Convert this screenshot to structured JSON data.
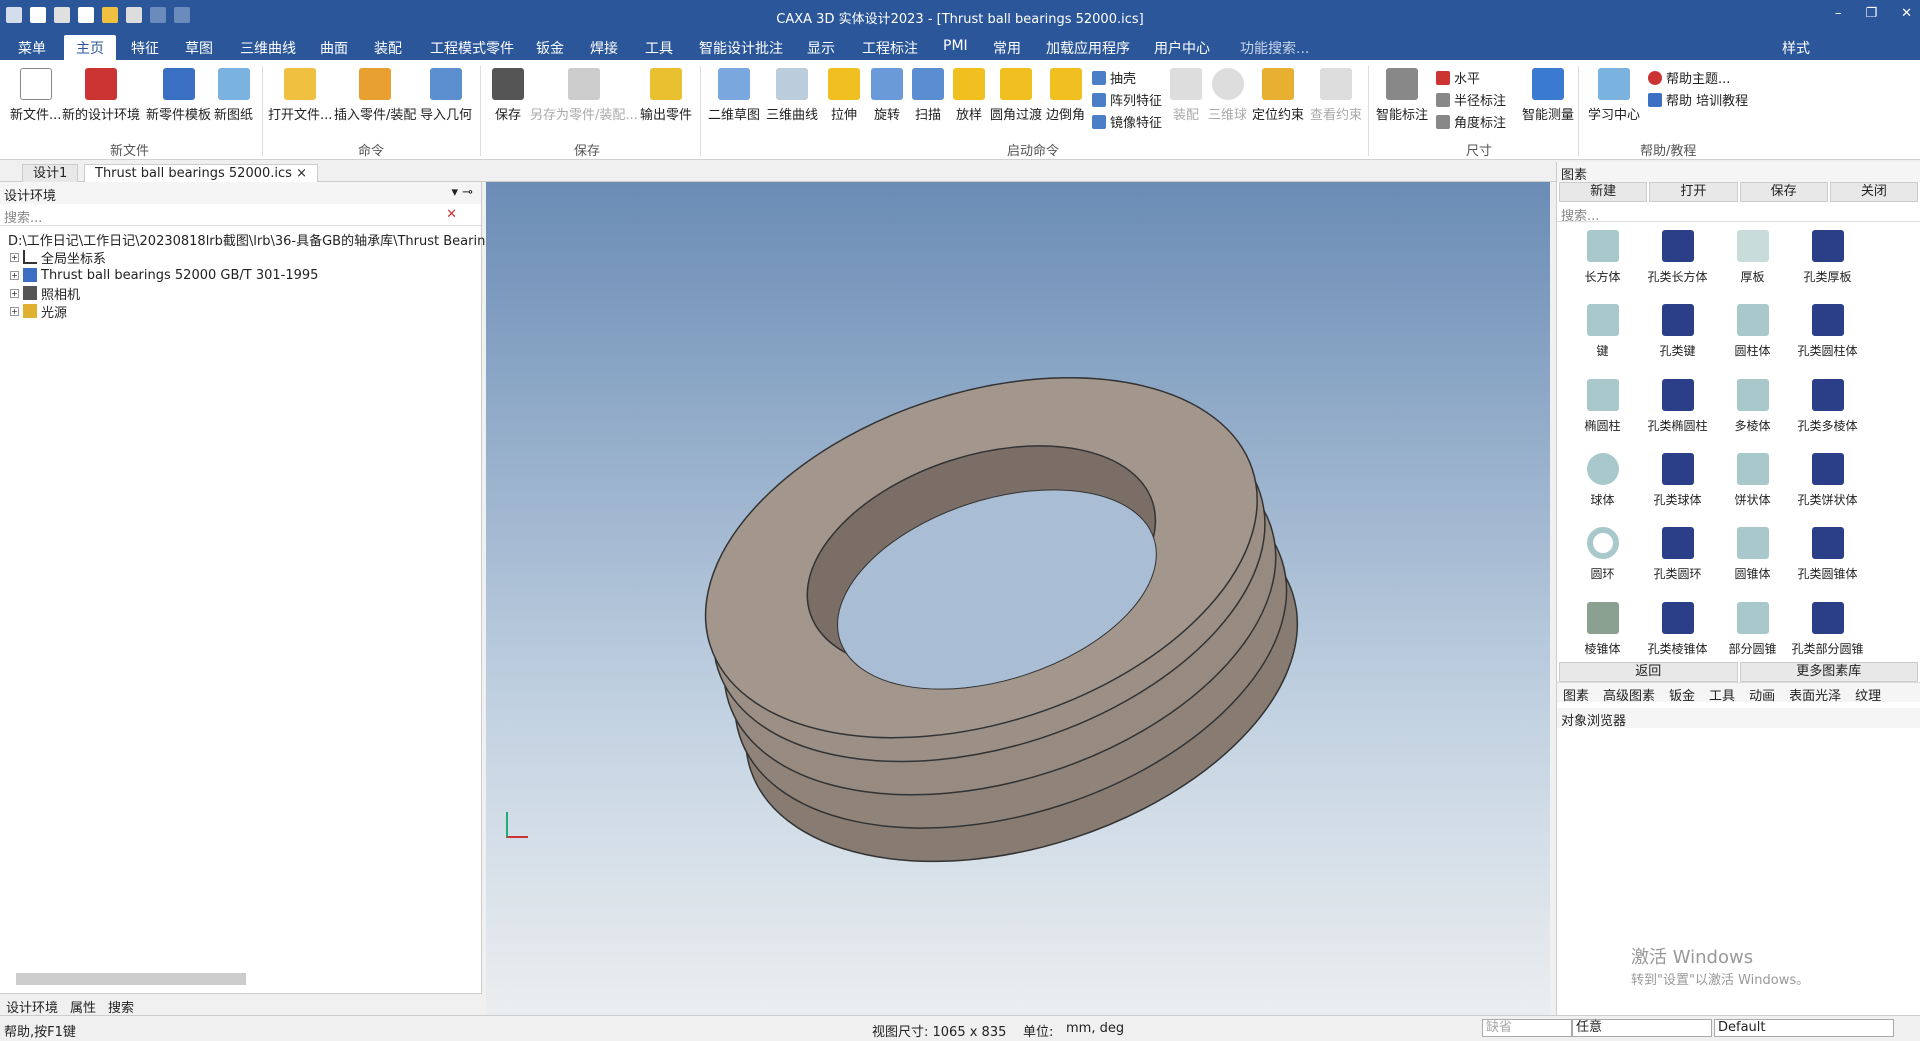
{
  "app": {
    "title": "CAXA 3D 实体设计2023 - [Thrust ball bearings 52000.ics]"
  },
  "menu": [
    "菜单",
    "主页",
    "特征",
    "草图",
    "三维曲线",
    "曲面",
    "装配",
    "工程模式零件",
    "钣金",
    "焊接",
    "工具",
    "智能设计批注",
    "显示",
    "工程标注",
    "PMI",
    "常用",
    "加载应用程序",
    "用户中心"
  ],
  "menu_search": "功能搜索...",
  "menu_right": "样式",
  "ribbon": {
    "new_file": [
      "新文件...",
      "新的设计环境",
      "新零件模板",
      "新图纸"
    ],
    "command": [
      "打开文件...",
      "插入零件/装配",
      "导入几何"
    ],
    "save": [
      "保存",
      "另存为零件/装配...",
      "输出零件"
    ],
    "launch": [
      "二维草图",
      "三维曲线",
      "拉伸",
      "旋转",
      "扫描",
      "放样",
      "圆角过渡",
      "边倒角"
    ],
    "launch_small": [
      "抽壳",
      "阵列特征",
      "镜像特征"
    ],
    "launch_dis": [
      "装配",
      "三维球",
      "定位约束",
      "查看约束"
    ],
    "dim": [
      "智能标注",
      "水平",
      "半径标注",
      "角度标注",
      "智能测量"
    ],
    "help": [
      "学习中心",
      "帮助主题...",
      "帮助 培训教程"
    ],
    "groups": [
      "新文件",
      "命令",
      "保存",
      "启动命令",
      "尺寸",
      "帮助/教程"
    ]
  },
  "doc_tabs": [
    "设计1",
    "Thrust ball bearings 52000.ics"
  ],
  "left": {
    "title": "设计环境",
    "search": "搜索...",
    "tree": [
      "D:\\工作日记\\工作日记\\20230818lrb截图\\lrb\\36-具备GB的轴承库\\Thrust Bearings\\",
      "全局坐标系",
      "Thrust ball bearings 52000 GB/T 301-1995",
      "照相机",
      "光源"
    ],
    "tabs": [
      "设计环境",
      "属性",
      "搜索"
    ]
  },
  "right": {
    "title": "图素",
    "buttons": [
      "新建",
      "打开",
      "保存",
      "关闭"
    ],
    "search": "搜索...",
    "items": [
      "长方体",
      "孔类长方体",
      "厚板",
      "孔类厚板",
      "键",
      "孔类键",
      "圆柱体",
      "孔类圆柱体",
      "椭圆柱",
      "孔类椭圆柱",
      "多棱体",
      "孔类多棱体",
      "球体",
      "孔类球体",
      "饼状体",
      "孔类饼状体",
      "圆环",
      "孔类圆环",
      "圆锥体",
      "孔类圆锥体",
      "棱锥体",
      "孔类棱锥体",
      "部分圆锥",
      "孔类部分圆锥"
    ],
    "back": "返回",
    "more": "更多图素库",
    "tabs": [
      "图素",
      "高级图素",
      "钣金",
      "工具",
      "动画",
      "表面光泽",
      "纹理"
    ],
    "obj_title": "对象浏览器"
  },
  "watermark": [
    "激活 Windows",
    "转到\"设置\"以激活 Windows。"
  ],
  "status": {
    "help": "帮助,按F1键",
    "view": "视图尺寸: 1065 x 835",
    "unit_label": "单位:",
    "unit": "mm, deg",
    "sel1": "缺省",
    "sel2": "任意",
    "sel3": "Default"
  },
  "colors": {
    "accent": "#2b579a",
    "model": "#9b8f86"
  }
}
